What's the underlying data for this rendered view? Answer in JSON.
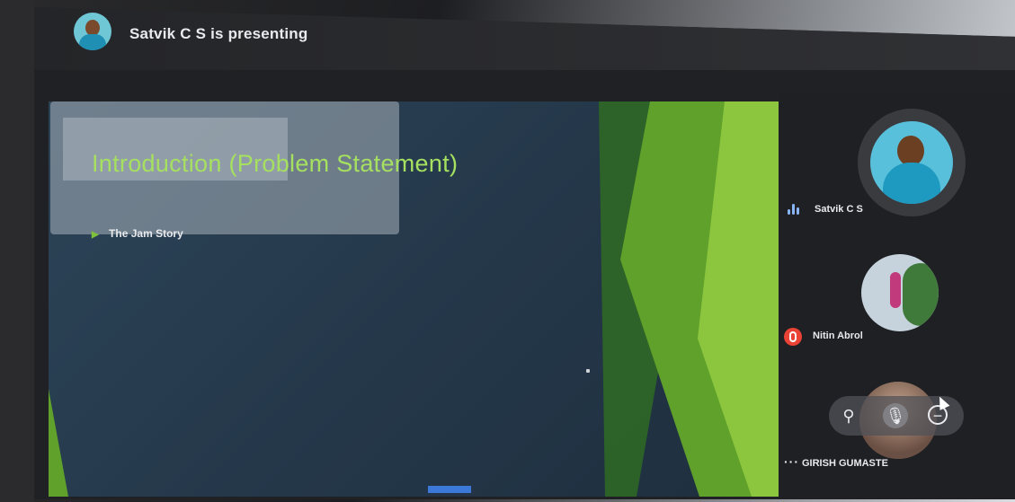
{
  "meeting": {
    "presenting_label": "Satvik C S is presenting"
  },
  "slide": {
    "title": "Introduction (Problem Statement)",
    "bullets": [
      "The Jam Story"
    ]
  },
  "participants": [
    {
      "name": "Satvik C S",
      "status": "speaking"
    },
    {
      "name": "Nitin Abrol",
      "status": "muted"
    },
    {
      "name": "GIRISH GUMASTE",
      "status": "hover-controls"
    }
  ],
  "icons": {
    "speaking": "speaking-indicator-icon",
    "muted": "mic-off-icon",
    "more": "more-options-icon",
    "pin": "pin-icon",
    "mic": "mic-icon",
    "remove": "remove-icon"
  },
  "colors": {
    "accent": "#8ab4f8",
    "muted_red": "#ea4335",
    "slide_title": "#a5e060",
    "slide_bg": "#2a3f52"
  }
}
